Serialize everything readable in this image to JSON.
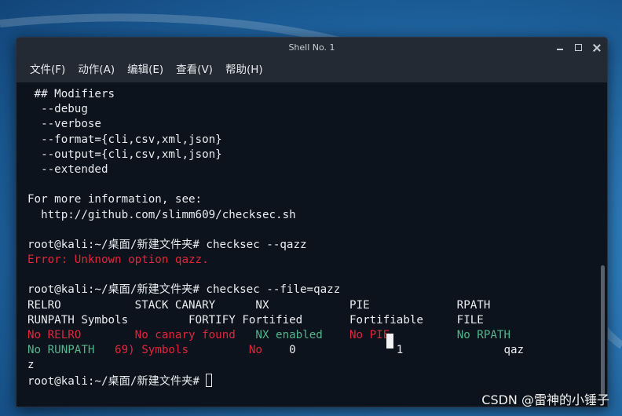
{
  "window": {
    "title": "Shell No. 1"
  },
  "menu": [
    "文件(F)",
    "动作(A)",
    "编辑(E)",
    "查看(V)",
    "帮助(H)"
  ],
  "terminal": {
    "lines": [
      {
        "segments": [
          {
            "text": " ## Modifiers",
            "color": "default"
          }
        ]
      },
      {
        "segments": [
          {
            "text": "  --debug",
            "color": "default"
          }
        ]
      },
      {
        "segments": [
          {
            "text": "  --verbose",
            "color": "default"
          }
        ]
      },
      {
        "segments": [
          {
            "text": "  --format={cli,csv,xml,json}",
            "color": "default"
          }
        ]
      },
      {
        "segments": [
          {
            "text": "  --output={cli,csv,xml,json}",
            "color": "default"
          }
        ]
      },
      {
        "segments": [
          {
            "text": "  --extended",
            "color": "default"
          }
        ]
      },
      {
        "segments": [
          {
            "text": "",
            "color": "default"
          }
        ]
      },
      {
        "segments": [
          {
            "text": "For more information, see:",
            "color": "default"
          }
        ]
      },
      {
        "segments": [
          {
            "text": "  http://github.com/slimm609/checksec.sh",
            "color": "default"
          }
        ]
      },
      {
        "segments": [
          {
            "text": "",
            "color": "default"
          }
        ]
      },
      {
        "segments": [
          {
            "text": "root@kali:~/桌面/新建文件夹# checksec --qazz",
            "color": "default"
          }
        ]
      },
      {
        "segments": [
          {
            "text": "Error: Unknown option qazz.",
            "color": "red"
          }
        ]
      },
      {
        "segments": [
          {
            "text": "",
            "color": "default"
          }
        ]
      },
      {
        "segments": [
          {
            "text": "root@kali:~/桌面/新建文件夹# checksec --file=qazz",
            "color": "default"
          }
        ]
      },
      {
        "segments": [
          {
            "text": "RELRO           STACK CANARY      NX            PIE             RPATH",
            "color": "default"
          }
        ]
      },
      {
        "segments": [
          {
            "text": "RUNPATH Symbols         FORTIFY Fortified       Fortifiable     FILE",
            "color": "default"
          }
        ]
      },
      {
        "segments": [
          {
            "text": "No RELRO        No canary found   ",
            "color": "red"
          },
          {
            "text": "NX enabled    ",
            "color": "green"
          },
          {
            "text": "No PIE          ",
            "color": "red"
          },
          {
            "text": "No RPATH",
            "color": "green"
          }
        ]
      },
      {
        "segments": [
          {
            "text": "No RUNPATH   ",
            "color": "green"
          },
          {
            "text": "69) Symbols         No    ",
            "color": "red"
          },
          {
            "text": "0               1               qaz",
            "color": "default"
          }
        ]
      },
      {
        "segments": [
          {
            "text": "z",
            "color": "default"
          }
        ]
      },
      {
        "segments": [
          {
            "text": "root@kali:~/桌面/新建文件夹# ",
            "color": "default"
          }
        ]
      }
    ]
  },
  "watermark": "CSDN @雷神的小锤子",
  "colors": {
    "default": "#e9edf1",
    "red": "#e0263b",
    "green": "#54b58c"
  }
}
